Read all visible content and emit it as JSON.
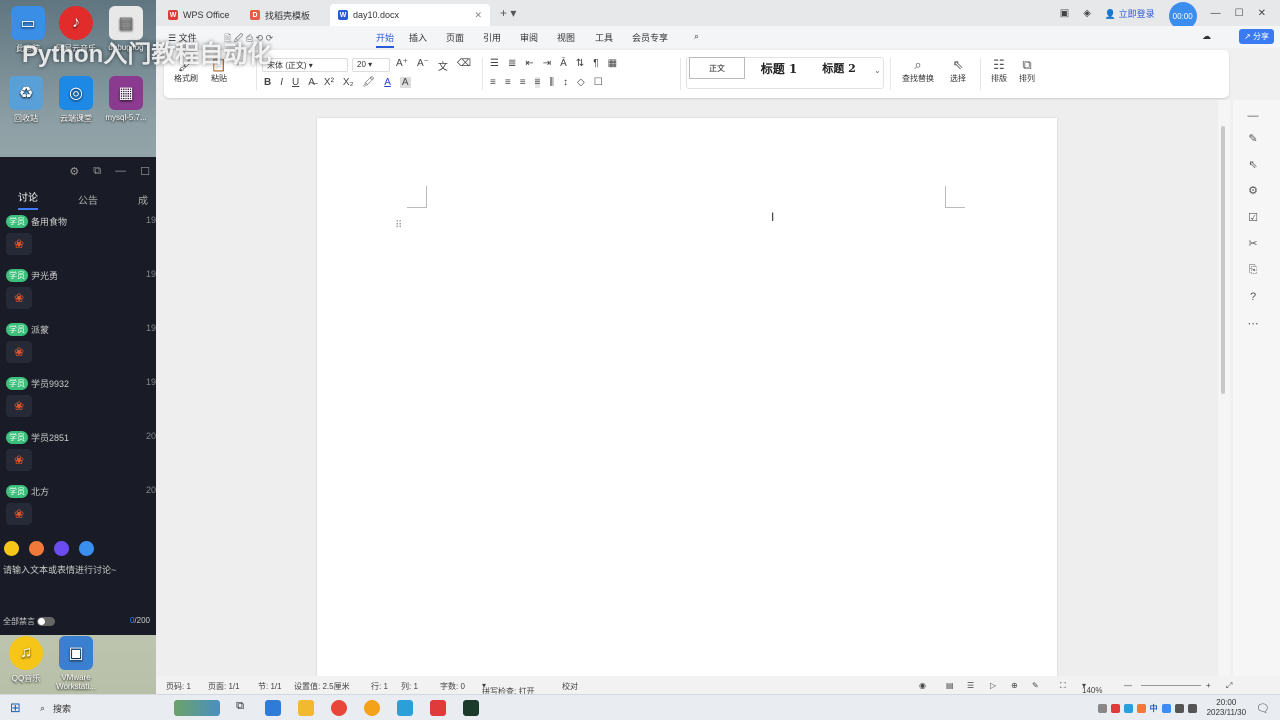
{
  "overlay_title": "Python入门教程自动化",
  "desktop": {
    "icons": [
      {
        "label": "此电脑",
        "name": "this-pc-icon",
        "color": "#3a8ee6"
      },
      {
        "label": "网易云音乐",
        "name": "netease-music-icon",
        "color": "#e22b2b"
      },
      {
        "label": "debug.log",
        "name": "log-file-icon",
        "color": "#e8e8e8"
      },
      {
        "label": "回收站",
        "name": "recycle-bin-icon",
        "color": "#5aa0d8"
      },
      {
        "label": "云端课堂",
        "name": "cloud-classroom-icon",
        "color": "#1e88e5"
      },
      {
        "label": "mysql-5.7...",
        "name": "winrar-archive-icon",
        "color": "#8a3b8f"
      },
      {
        "label": "QQ音乐",
        "name": "qq-music-icon",
        "color": "#f5c518"
      },
      {
        "label": "VMware Workstati...",
        "name": "vmware-icon",
        "color": "#3a7fd0"
      }
    ]
  },
  "chat": {
    "tabs": [
      "讨论",
      "公告",
      "成"
    ],
    "messages": [
      {
        "badge": "学员",
        "name": "备用食物",
        "time": "19"
      },
      {
        "badge": "学员",
        "name": "尹光勇",
        "time": "19"
      },
      {
        "badge": "学员",
        "name": "派蒙",
        "time": "19"
      },
      {
        "badge": "学员",
        "name": "学员9932",
        "time": "19"
      },
      {
        "badge": "学员",
        "name": "学员2851",
        "time": "20"
      },
      {
        "badge": "学员",
        "name": "北方",
        "time": "20"
      }
    ],
    "input_placeholder": "请输入文本或表情进行讨论~",
    "mute_all": "全部禁言",
    "char_count": "0",
    "char_limit": "/200"
  },
  "wps": {
    "tabs": [
      {
        "label": "WPS Office",
        "color": "#e03a3a",
        "mark": "W"
      },
      {
        "label": "找稻壳模板",
        "color": "#e85b4a",
        "mark": "D"
      },
      {
        "label": "day10.docx",
        "color": "#2a5bd7",
        "mark": "W"
      }
    ],
    "login": "立即登录",
    "avatar_time": "00:00",
    "menu": [
      "文件",
      "开始",
      "插入",
      "页面",
      "引用",
      "审阅",
      "视图",
      "工具",
      "会员专享"
    ],
    "share": "分享",
    "ribbon": {
      "format_painter": "格式刷",
      "paste": "粘贴",
      "font_name": "宋体 (正文)",
      "font_size": "20",
      "styles": [
        "正文",
        "标题 1",
        "标题 2"
      ],
      "find_replace": "查找替换",
      "select": "选择",
      "layout": "排版",
      "arrange": "排列"
    },
    "status": {
      "page_num": "页码: 1",
      "page_of": "页面: 1/1",
      "section": "节: 1/1",
      "position": "设置值: 2.5厘米",
      "row": "行: 1",
      "col": "列: 1",
      "word_count": "字数: 0",
      "spell_check": "拼写检查: 打开",
      "proofread": "校对",
      "zoom": "140%"
    }
  },
  "taskbar": {
    "search": "搜索",
    "time": "20:00",
    "date": "2023/11/30",
    "ime": "中"
  }
}
